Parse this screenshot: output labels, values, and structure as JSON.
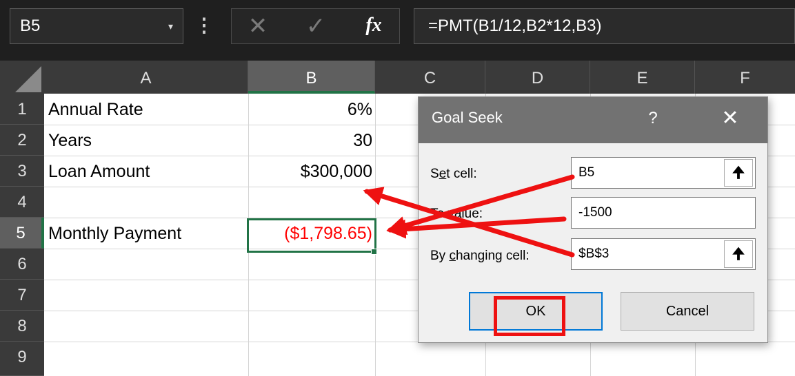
{
  "formula_bar": {
    "name_box": "B5",
    "name_box_dropdown": "▾",
    "more_icon": "⋮",
    "cancel_icon": "✕",
    "enter_icon": "✓",
    "fx_label": "fx",
    "formula": "=PMT(B1/12,B2*12,B3)"
  },
  "columns": [
    "A",
    "B",
    "C",
    "D",
    "E",
    "F"
  ],
  "rows": [
    "1",
    "2",
    "3",
    "4",
    "5",
    "6",
    "7",
    "8",
    "9"
  ],
  "cells": {
    "A1": "Annual Rate",
    "B1": "6%",
    "A2": "Years",
    "B2": "30",
    "A3": "Loan Amount",
    "B3": "$300,000",
    "A5": "Monthly Payment",
    "B5": "($1,798.65)"
  },
  "selected_cell": "B5",
  "dialog": {
    "title": "Goal Seek",
    "help": "?",
    "close": "✕",
    "set_cell_label_pre": "S",
    "set_cell_label_u": "e",
    "set_cell_label_post": "t cell:",
    "set_cell_value": "B5",
    "to_value_label": "To value:",
    "to_value_value": "-1500",
    "by_changing_label_pre": "By ",
    "by_changing_label_u": "c",
    "by_changing_label_post": "hanging cell:",
    "by_changing_value": "$B$3",
    "ref_icon": "🠉",
    "ok": "OK",
    "cancel": "Cancel"
  },
  "colors": {
    "accent_green": "#217346",
    "annotation_red": "#ee1111",
    "negative_red": "#ff0000",
    "focus_blue": "#0078d7"
  }
}
